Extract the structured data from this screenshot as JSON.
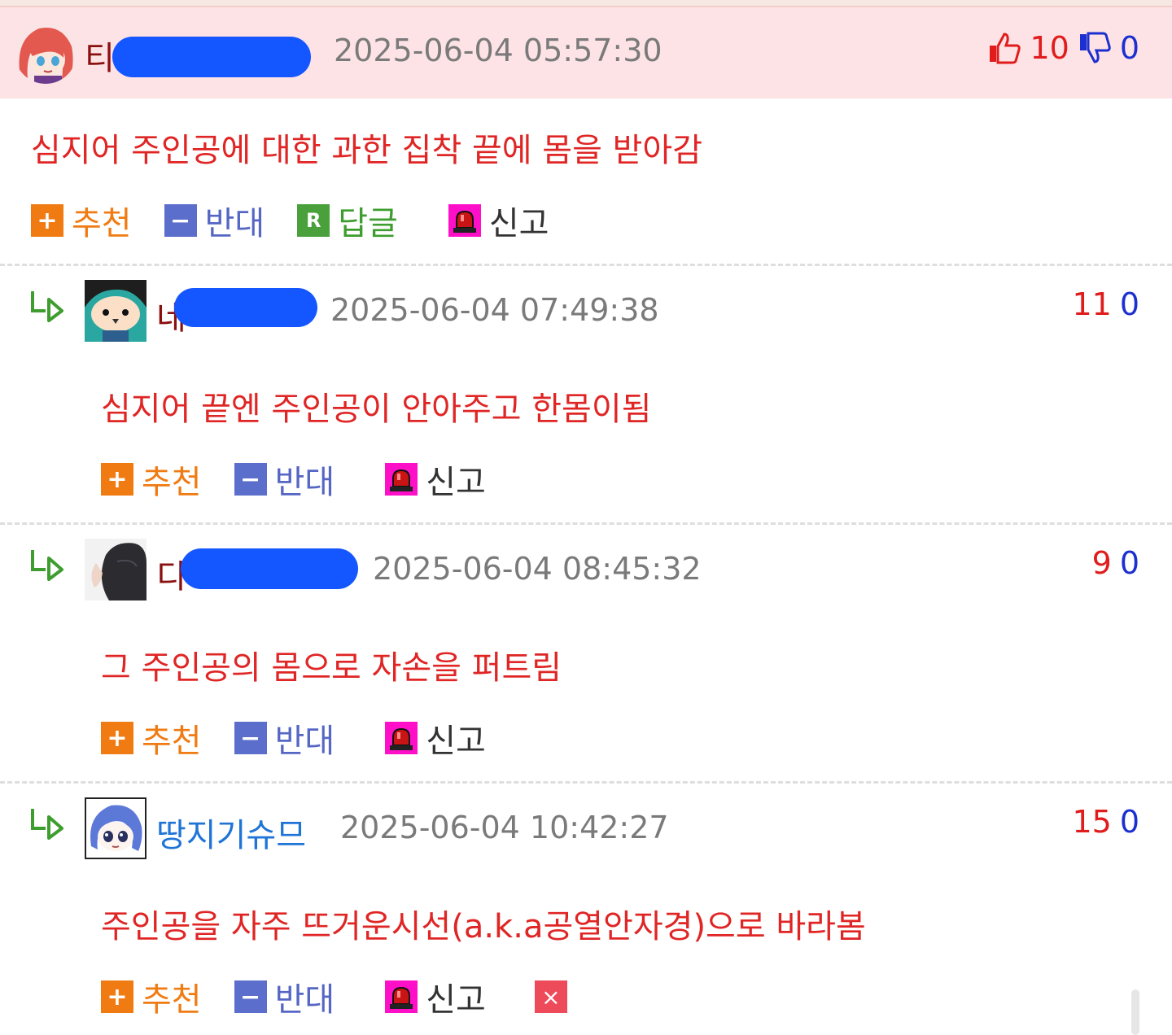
{
  "comments": [
    {
      "nickname": "티",
      "timestamp": "2025-06-04 05:57:30",
      "upvotes": "10",
      "downvotes": "0",
      "text": "심지어 주인공에 대한 과한 집착 끝에 몸을 받아감",
      "actions": {
        "recommend": "추천",
        "oppose": "반대",
        "reply": "답글",
        "report": "신고"
      },
      "icons": {
        "reply_badge": "R",
        "plus": "+",
        "minus": "−"
      }
    },
    {
      "nickname": "네",
      "timestamp": "2025-06-04 07:49:38",
      "upvotes": "11",
      "downvotes": "0",
      "text": "심지어 끝엔 주인공이 안아주고 한몸이됨",
      "actions": {
        "recommend": "추천",
        "oppose": "반대",
        "report": "신고"
      }
    },
    {
      "nickname": "디",
      "timestamp": "2025-06-04 08:45:32",
      "upvotes": "9",
      "downvotes": "0",
      "text": "그 주인공의 몸으로 자손을 퍼트림",
      "actions": {
        "recommend": "추천",
        "oppose": "반대",
        "report": "신고"
      }
    },
    {
      "nickname": "땅지기슈므",
      "timestamp": "2025-06-04 10:42:27",
      "upvotes": "15",
      "downvotes": "0",
      "text": "주인공을 자주 뜨거운시선(a.k.a공열안자경)으로 바라봄",
      "actions": {
        "recommend": "추천",
        "oppose": "반대",
        "report": "신고",
        "delete": "×"
      }
    }
  ],
  "colors": {
    "highlight_bg": "#fde3e5",
    "upvote": "#e01c1c",
    "downvote": "#1c2fd0",
    "comment_text": "#e02525",
    "recommend": "#f07b12",
    "oppose": "#5b6ecb",
    "reply": "#4aa03a",
    "report": "#ff10c8",
    "redaction": "#1456ff"
  }
}
